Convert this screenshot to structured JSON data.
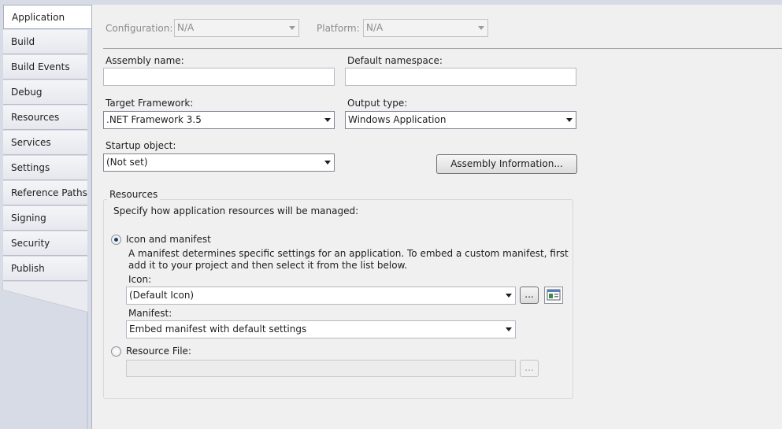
{
  "sidebar": {
    "tabs": [
      {
        "label": "Application",
        "active": true
      },
      {
        "label": "Build"
      },
      {
        "label": "Build Events"
      },
      {
        "label": "Debug"
      },
      {
        "label": "Resources"
      },
      {
        "label": "Services"
      },
      {
        "label": "Settings"
      },
      {
        "label": "Reference Paths"
      },
      {
        "label": "Signing"
      },
      {
        "label": "Security"
      },
      {
        "label": "Publish"
      }
    ]
  },
  "header": {
    "configuration_label": "Configuration:",
    "configuration_value": "N/A",
    "platform_label": "Platform:",
    "platform_value": "N/A"
  },
  "form": {
    "assembly_name_label": "Assembly name:",
    "assembly_name_value": "",
    "default_namespace_label": "Default namespace:",
    "default_namespace_value": "",
    "target_framework_label": "Target Framework:",
    "target_framework_value": ".NET Framework 3.5",
    "output_type_label": "Output type:",
    "output_type_value": "Windows Application",
    "startup_object_label": "Startup object:",
    "startup_object_value": "(Not set)",
    "assembly_info_button": "Assembly Information..."
  },
  "resources": {
    "group_title": "Resources",
    "instruction": "Specify how application resources will be managed:",
    "icon_manifest_label": "Icon and manifest",
    "icon_manifest_checked": true,
    "description": "A manifest determines specific settings for an application. To embed a custom manifest, first add it to your project and then select it from the list below.",
    "icon_label": "Icon:",
    "icon_value": "(Default Icon)",
    "browse_label": "...",
    "manifest_label": "Manifest:",
    "manifest_value": "Embed manifest with default settings",
    "resource_file_label": "Resource File:",
    "resource_file_checked": false,
    "resource_file_value": "",
    "resource_browse_label": "..."
  }
}
